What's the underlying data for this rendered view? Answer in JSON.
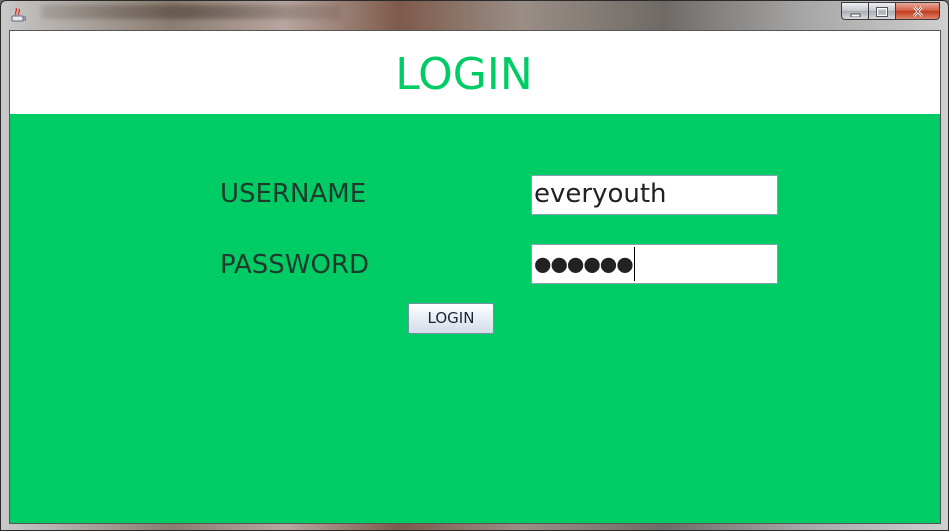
{
  "window": {
    "app_icon": "java-icon",
    "controls": [
      "minimize-icon",
      "maximize-icon",
      "close-icon"
    ]
  },
  "header": {
    "title": "LOGIN"
  },
  "form": {
    "username_label": "USERNAME",
    "username_value": "everyouth",
    "password_label": "PASSWORD",
    "password_masked": "●●●●●●",
    "login_button": "LOGIN"
  },
  "colors": {
    "form_background": "#00cc66",
    "header_background": "#ffffff",
    "title_color": "#00cc66",
    "label_color": "#1e3a2b"
  }
}
